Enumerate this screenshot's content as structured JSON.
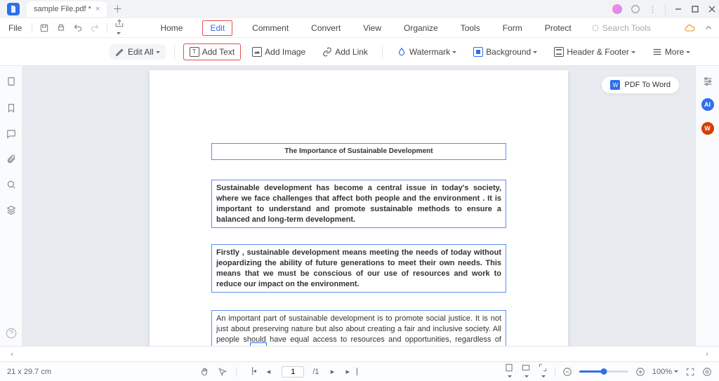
{
  "title_bar": {
    "tab_title": "sample File.pdf *"
  },
  "menu": {
    "file": "File",
    "items": [
      "Home",
      "Edit",
      "Comment",
      "Convert",
      "View",
      "Organize",
      "Tools",
      "Form",
      "Protect"
    ],
    "active_index": 1,
    "search_placeholder": "Search Tools"
  },
  "toolbar": {
    "edit_all": "Edit All",
    "add_text": "Add Text",
    "add_image": "Add Image",
    "add_link": "Add Link",
    "watermark": "Watermark",
    "background": "Background",
    "header_footer": "Header & Footer",
    "more": "More"
  },
  "floating": {
    "pdf_to_word": "PDF To Word"
  },
  "document": {
    "title": "The Importance of Sustainable Development",
    "p1": "Sustainable development has become a central issue in today's society, where we face challenges that affect both people and the environment . It is important to understand and promote sustainable methods to ensure a balanced and long-term development.",
    "p2": "Firstly , sustainable development means meeting the needs of today without jeopardizing the ability of future generations to meet their own needs. This means that we must be conscious of our use of resources and work to reduce our impact on the environment.",
    "p3": "An important part of sustainable development is to promote social justice. It is not just about preserving nature but also about creating a fair and inclusive society. All people should have equal access to resources and opportunities, regardless of their background or origin."
  },
  "status": {
    "page_size": "21 x 29.7 cm",
    "current_page": "1",
    "total_pages_sep": "/1",
    "zoom": "100%"
  }
}
